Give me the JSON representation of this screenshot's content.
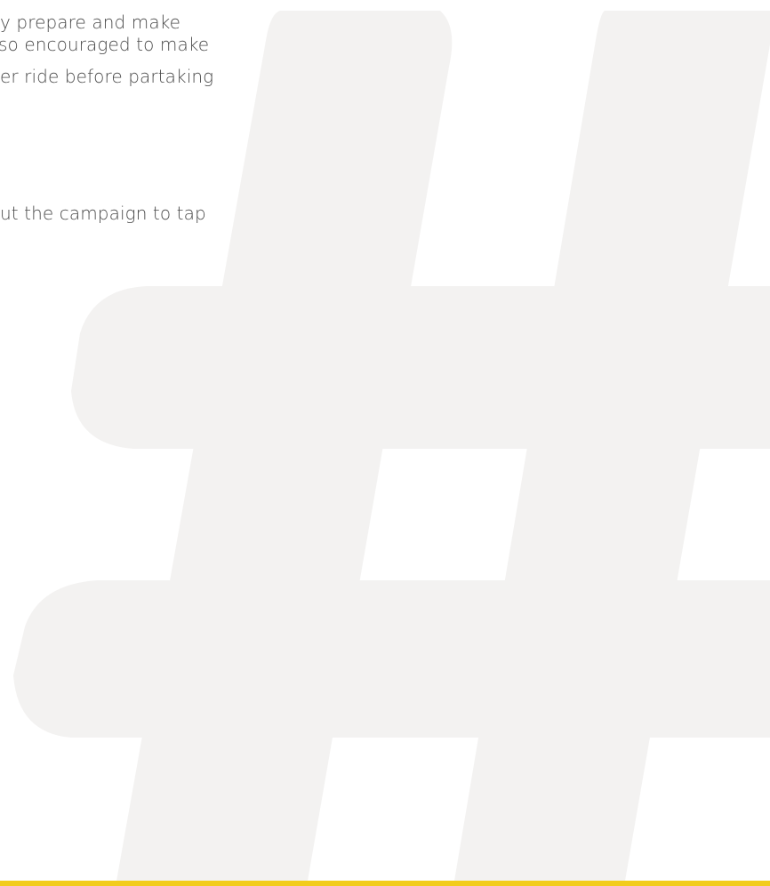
{
  "body_text": {
    "lines": [
      "y prepare and make",
      "so encouraged to make",
      "er ride before partaking",
      "ut the campaign to tap"
    ]
  },
  "decoration": {
    "icon": "hashtag-icon",
    "hashtag_color": "#f3f2f1",
    "accent_color": "#f2cc1c",
    "text_color": "#4a4a4a"
  }
}
